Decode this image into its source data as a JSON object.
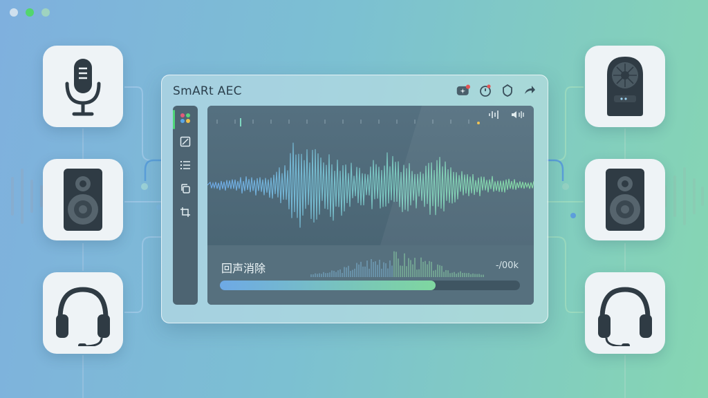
{
  "window": {
    "title": "SmARt AEC",
    "actions": [
      {
        "icon": "sparkle-icon"
      },
      {
        "icon": "timer-icon"
      },
      {
        "icon": "badge-icon"
      },
      {
        "icon": "share-arrow-icon"
      }
    ]
  },
  "sidebar": {
    "items": [
      {
        "icon": "palette-icon"
      },
      {
        "icon": "edit-square-icon"
      },
      {
        "icon": "list-icon"
      },
      {
        "icon": "copy-icon"
      },
      {
        "icon": "crop-icon"
      }
    ]
  },
  "panel": {
    "wave_controls": [
      {
        "icon": "waveform-small-icon"
      },
      {
        "icon": "volume-icon"
      }
    ],
    "label": "回声消除",
    "value": "-/00k",
    "progress": 0.72
  },
  "devices": {
    "left": [
      {
        "icon": "microphone-icon"
      },
      {
        "icon": "speaker-icon"
      },
      {
        "icon": "headphones-icon"
      }
    ],
    "right": [
      {
        "icon": "smart-speaker-icon"
      },
      {
        "icon": "speaker-icon"
      },
      {
        "icon": "headphones-icon"
      }
    ]
  },
  "colors": {
    "accent_green": "#4fd67a",
    "wave_blue": "#6ea9e6",
    "wave_green": "#7fd79f",
    "window_red": "#e35555"
  }
}
